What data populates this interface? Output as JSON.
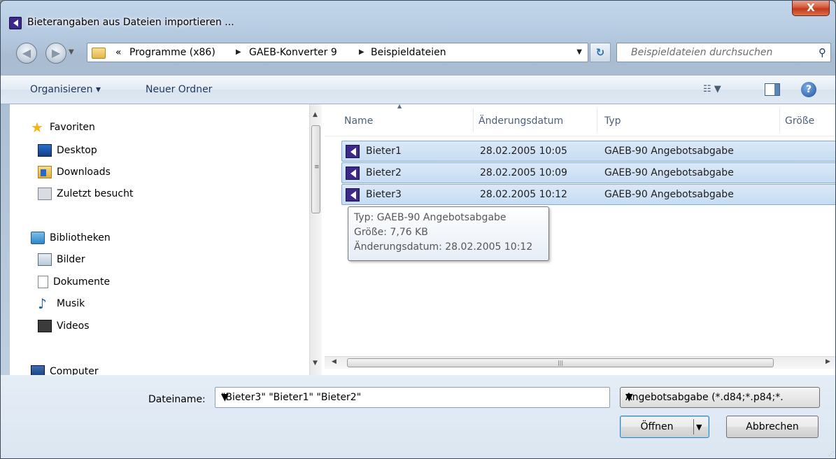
{
  "window": {
    "title": "Bieterangaben aus Dateien importieren ...",
    "close_label": "X"
  },
  "address": {
    "overflow": "«",
    "breadcrumbs": [
      "Programme (x86)",
      "GAEB-Konverter 9",
      "Beispieldateien"
    ],
    "search_placeholder": "Beispieldateien durchsuchen"
  },
  "toolbar": {
    "organize": "Organisieren ▾",
    "new_folder": "Neuer Ordner",
    "help": "?"
  },
  "nav": {
    "favorites": "Favoriten",
    "fav_items": [
      "Desktop",
      "Downloads",
      "Zuletzt besucht"
    ],
    "libraries": "Bibliotheken",
    "lib_items": [
      "Bilder",
      "Dokumente",
      "Musik",
      "Videos"
    ],
    "computer": "Computer"
  },
  "files": {
    "columns": [
      "Name",
      "Änderungsdatum",
      "Typ",
      "Größe"
    ],
    "rows": [
      {
        "name": "Bieter1",
        "date": "28.02.2005 10:05",
        "type": "GAEB-90 Angebotsabgabe"
      },
      {
        "name": "Bieter2",
        "date": "28.02.2005 10:09",
        "type": "GAEB-90 Angebotsabgabe"
      },
      {
        "name": "Bieter3",
        "date": "28.02.2005 10:12",
        "type": "GAEB-90 Angebotsabgabe"
      }
    ]
  },
  "tooltip": {
    "line1": "Typ: GAEB-90 Angebotsabgabe",
    "line2": "Größe: 7,76 KB",
    "line3": "Änderungsdatum: 28.02.2005 10:12"
  },
  "bottom": {
    "filename_label": "Dateiname:",
    "filename_value": "\"Bieter3\" \"Bieter1\" \"Bieter2\"",
    "filetype_value": "Angebotsabgabe (*.d84;*.p84;*.",
    "open_label": "Öffnen",
    "cancel_label": "Abbrechen"
  }
}
